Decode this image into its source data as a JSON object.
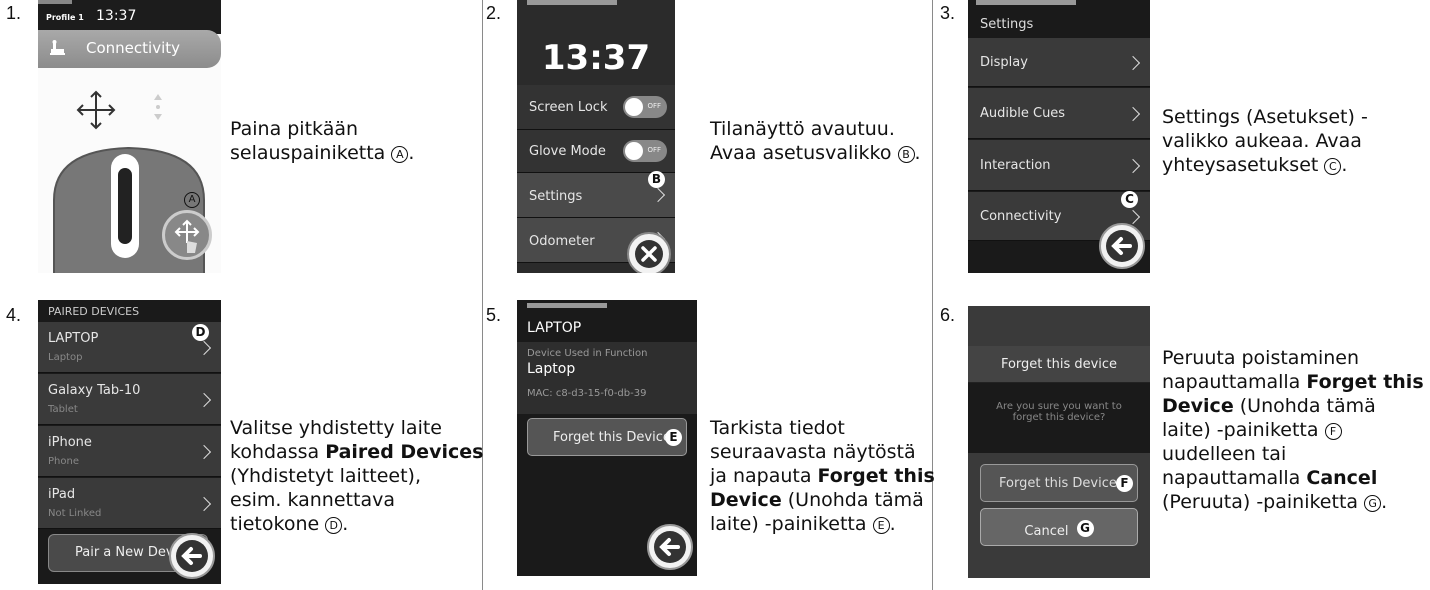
{
  "steps": [
    {
      "number": "1.",
      "screen": {
        "profile": "Profile 1",
        "time": "13:37",
        "header": "Connectivity",
        "marker": "A"
      },
      "desc_lines": [
        "Paina pitkään",
        "selauspainiketta"
      ],
      "desc_marker": "A"
    },
    {
      "number": "2.",
      "screen": {
        "time": "13:37",
        "rows": [
          {
            "label": "Screen Lock",
            "toggle": "OFF"
          },
          {
            "label": "Glove Mode",
            "toggle": "OFF"
          },
          {
            "label": "Settings"
          },
          {
            "label": "Odometer"
          }
        ],
        "marker": "B"
      },
      "desc_lines": [
        "Tilanäyttö avautuu.",
        "Avaa asetusvalikko"
      ],
      "desc_marker": "B"
    },
    {
      "number": "3.",
      "screen": {
        "title": "Settings",
        "rows": [
          "Display",
          "Audible Cues",
          "Interaction",
          "Connectivity"
        ],
        "marker": "C"
      },
      "desc_lines": [
        "Settings (Asetukset) -",
        "valikko aukeaa. Avaa",
        "yhteysasetukset"
      ],
      "desc_marker": "C"
    },
    {
      "number": "4.",
      "screen": {
        "title": "PAIRED DEVICES",
        "devices": [
          {
            "name": "LAPTOP",
            "type": "Laptop"
          },
          {
            "name": "Galaxy Tab-10",
            "type": "Tablet"
          },
          {
            "name": "iPhone",
            "type": "Phone"
          },
          {
            "name": "iPad",
            "type": "Not Linked"
          }
        ],
        "pair_button": "Pair a New Devi",
        "marker": "D"
      },
      "desc": {
        "l1": "Valitse yhdistetty laite",
        "l2a": "kohdassa ",
        "l2b": "Paired Devices",
        "l3": "(Yhdistetyt laitteet),",
        "l4": "esim. kannettava",
        "l5": "tietokone"
      },
      "desc_marker": "D"
    },
    {
      "number": "5.",
      "screen": {
        "title": "LAPTOP",
        "sub_label": "Device Used in Function",
        "sub_value": "Laptop",
        "mac": "MAC: c8-d3-15-f0-db-39",
        "forget_button": "Forget this Device",
        "marker": "E"
      },
      "desc": {
        "l1": "Tarkista tiedot",
        "l2": "seuraavasta näytöstä",
        "l3a": "ja napauta ",
        "l3b": "Forget this",
        "l4a": "Device",
        "l4b": " (Unohda tämä",
        "l5": "laite) -painiketta"
      },
      "desc_marker": "E"
    },
    {
      "number": "6.",
      "screen": {
        "dialog_title": "Forget this device",
        "dialog_q1": "Are you sure you want to",
        "dialog_q2": "forget this device?",
        "forget_button": "Forget this Device",
        "cancel_button": "Cancel",
        "marker_forget": "F",
        "marker_cancel": "G"
      },
      "desc": {
        "l1": "Peruuta poistaminen",
        "l2a": "napauttamalla ",
        "l2b": "Forget this",
        "l3a": "Device",
        "l3b": " (Unohda tämä",
        "l4": "laite) -painiketta",
        "l5": "uudelleen tai",
        "l6a": "napauttamalla ",
        "l6b": "Cancel",
        "l7": "(Peruuta) -painiketta"
      },
      "desc_marker_f": "F",
      "desc_marker_g": "G"
    }
  ]
}
